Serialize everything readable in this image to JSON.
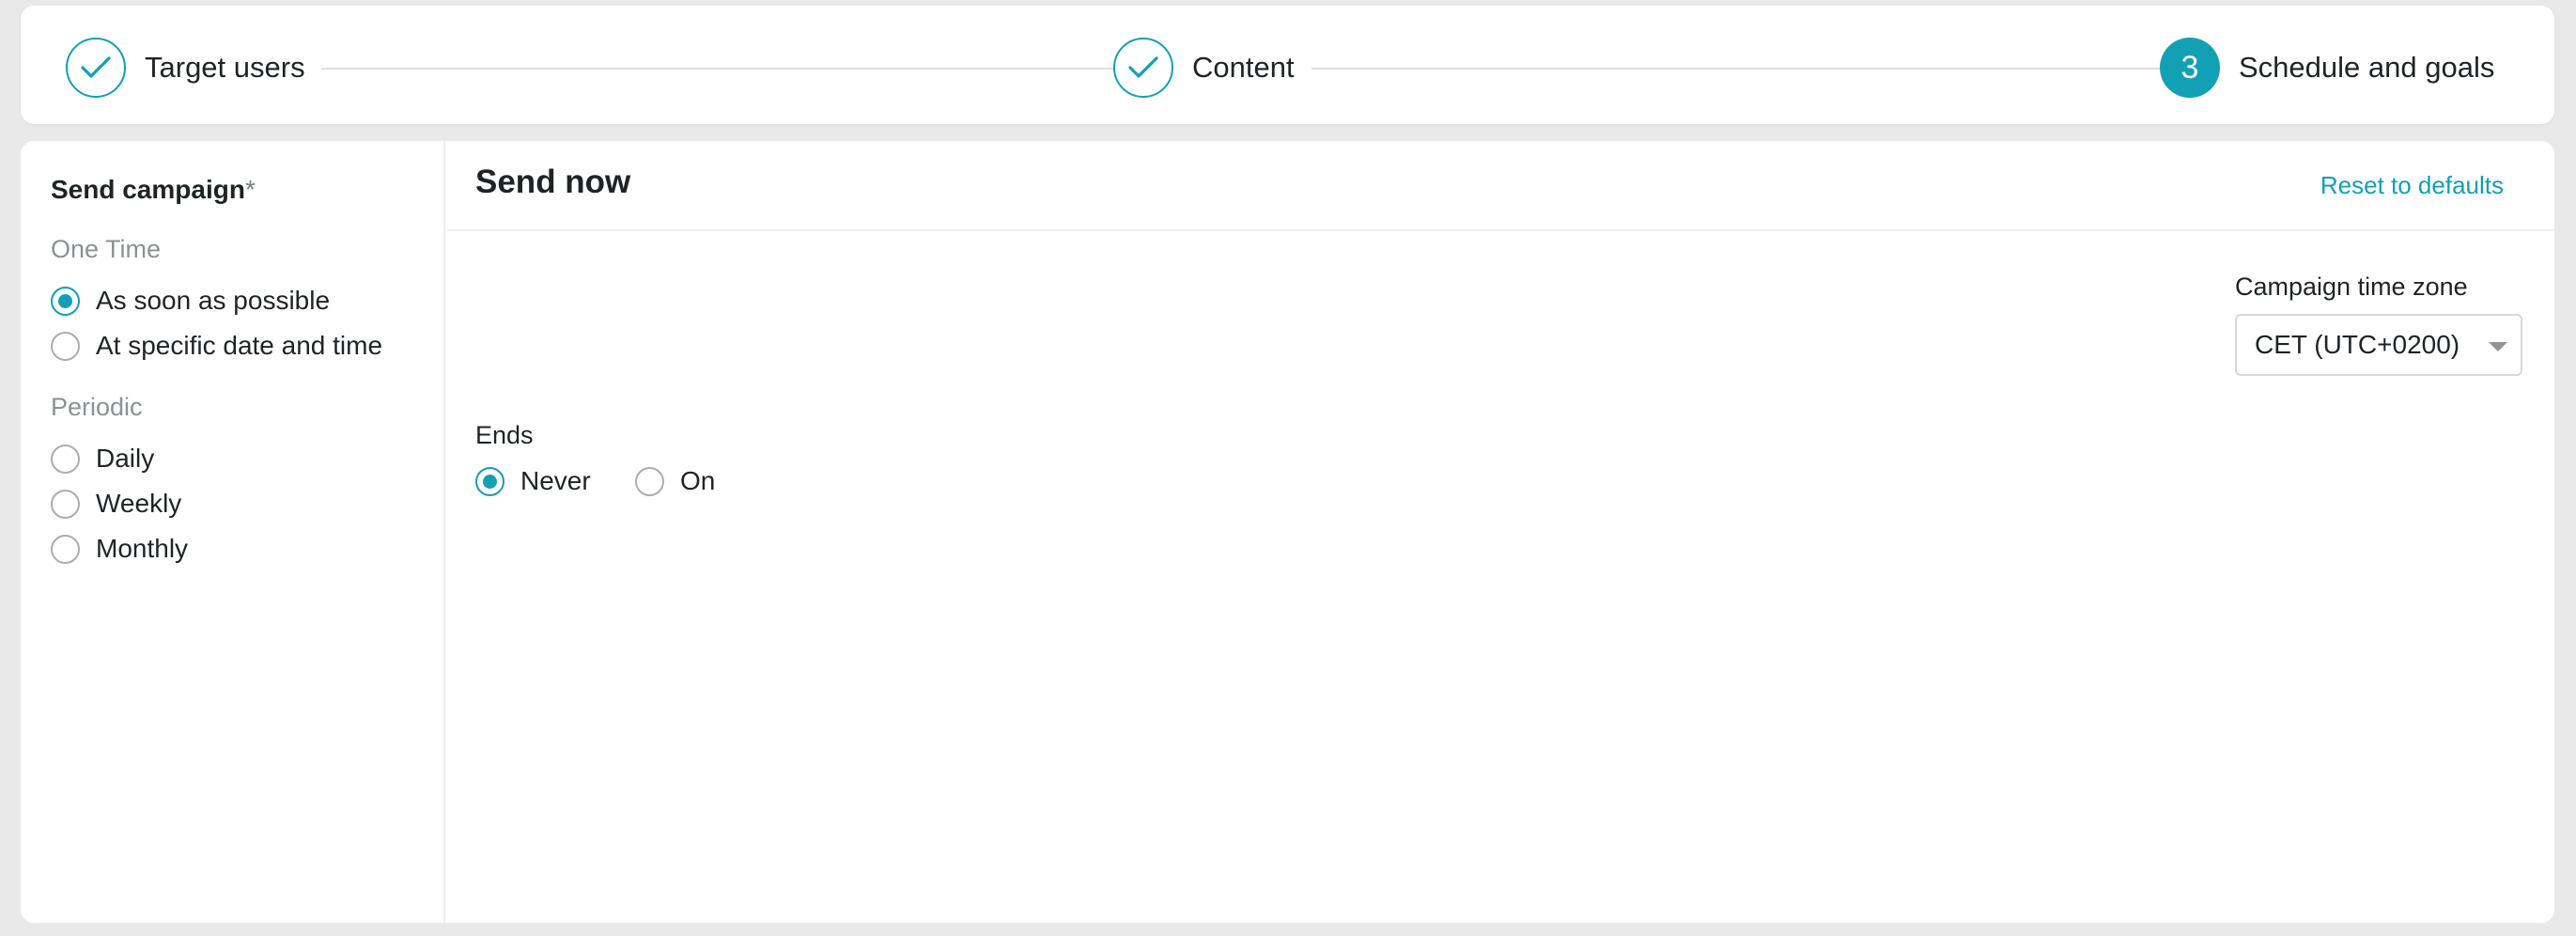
{
  "stepper": {
    "steps": [
      {
        "label": "Target users",
        "state": "done",
        "icon": "check-icon"
      },
      {
        "label": "Content",
        "state": "done",
        "icon": "check-icon"
      },
      {
        "label": "Schedule and goals",
        "state": "active",
        "number": "3"
      }
    ]
  },
  "send_campaign": {
    "title": "Send campaign",
    "required_mark": "*",
    "one_time": {
      "title": "One Time",
      "options": [
        {
          "label": "As soon as possible",
          "selected": true
        },
        {
          "label": "At specific date and time",
          "selected": false
        }
      ]
    },
    "periodic": {
      "title": "Periodic",
      "options": [
        {
          "label": "Daily",
          "selected": false
        },
        {
          "label": "Weekly",
          "selected": false
        },
        {
          "label": "Monthly",
          "selected": false
        }
      ]
    }
  },
  "send_now": {
    "title": "Send now",
    "reset_label": "Reset to defaults",
    "timezone": {
      "label": "Campaign time zone",
      "value": "CET (UTC+0200)"
    },
    "ends": {
      "label": "Ends",
      "options": [
        {
          "label": "Never",
          "selected": true
        },
        {
          "label": "On",
          "selected": false
        }
      ]
    }
  },
  "colors": {
    "accent": "#12a0b4",
    "background": "#e9e9e9",
    "card": "#ffffff"
  }
}
